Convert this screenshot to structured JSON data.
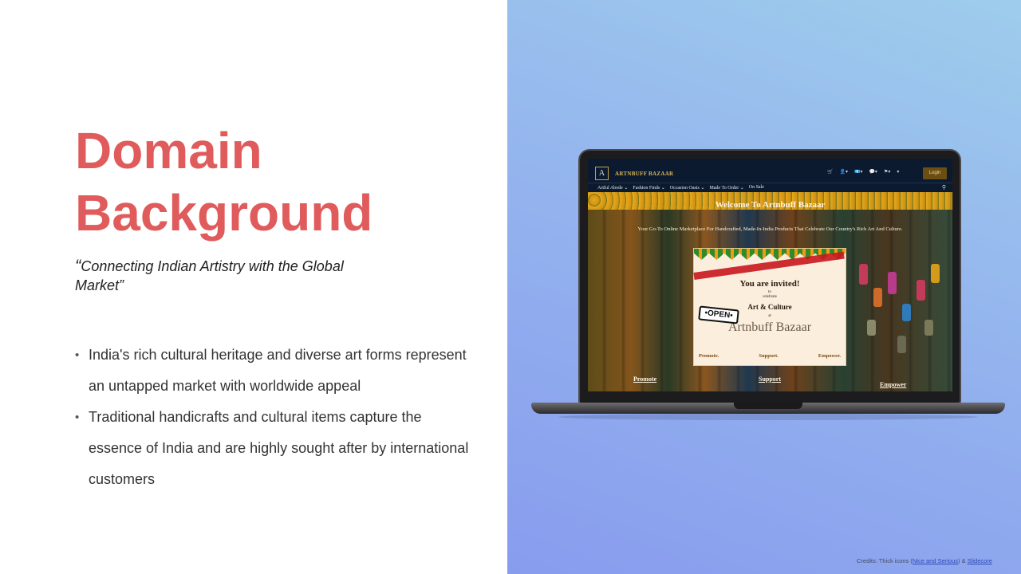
{
  "slide": {
    "title_line1": "Domain",
    "title_line2": "Background",
    "quote_open": "“",
    "quote_text": "Connecting Indian Artistry with the Global Market”",
    "bullets": [
      "India's rich cultural heritage and diverse art forms represent an untapped market with worldwide appeal",
      "Traditional handicrafts and cultural items capture the essence of India and are highly sought after by international customers"
    ],
    "colors": {
      "title": "#e05b5b",
      "panel_top": "#9ecdec",
      "panel_bottom": "#889cee"
    },
    "credits": {
      "prefix": "Credits: Thick icons (",
      "link1": "Nice and Serious",
      "middle": ") & ",
      "link2": "Slidecore"
    }
  },
  "website": {
    "logo_letter": "A",
    "brand": "ARTNBUFF BAZAAR",
    "header_icons": [
      "cart-icon",
      "user-icon",
      "currency-icon",
      "chat-icon",
      "flag-icon"
    ],
    "login_label": "Login",
    "nav": [
      "Artful Abode",
      "Fashion Finds",
      "Occasion Oasis",
      "Made To Order",
      "On Sale"
    ],
    "hero_title": "Welcome To Artnbuff Bazaar",
    "hero_subtitle": "Your Go-To Online Marketplace For Handcrafted, Made-In-India Products That Celebrate Our Country's Rich Art And Culture.",
    "invite": {
      "headline": "You are invited!",
      "small": "to",
      "small2": "celebrate",
      "middle": "Art & Culture",
      "at": "at",
      "brand": "Artnbuff Bazaar",
      "open_sign": "•OPEN•",
      "words": [
        "Promote.",
        "Support.",
        "Empower."
      ]
    },
    "footer_links": [
      "Promote",
      "Support",
      "Empower"
    ]
  }
}
